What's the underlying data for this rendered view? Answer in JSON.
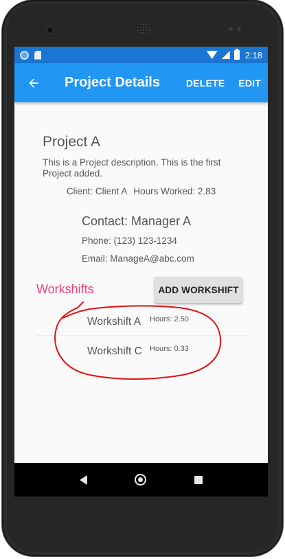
{
  "status_bar": {
    "time": "2:18",
    "icons": [
      "notification-icon",
      "sd-card-icon",
      "wifi-icon",
      "signal-icon",
      "battery-charging-icon"
    ]
  },
  "app_bar": {
    "back_icon": "arrow-back-icon",
    "title": "Project Details",
    "delete_label": "DELETE",
    "edit_label": "EDIT",
    "background_color": "#2196f3",
    "status_color": "#1976d2"
  },
  "project": {
    "name": "Project A",
    "description": "This is a Project description. This is the first Project added.",
    "client": "Client: Client A",
    "hours_worked": "Hours Worked: 2.83"
  },
  "contact": {
    "name": "Contact: Manager A",
    "phone": "Phone: (123) 123-1234",
    "email": "Email: ManageA@abc.com"
  },
  "workshifts": {
    "title": "Workshifts",
    "title_color": "#ec407a",
    "add_label": "ADD WORKSHIFT",
    "items": [
      {
        "name": "Workshift A",
        "hours": "Hours: 2.50"
      },
      {
        "name": "Workshift C",
        "hours": "Hours: 0.33"
      }
    ]
  },
  "annotation": {
    "color": "#e01010"
  },
  "nav_bar": {
    "icons": [
      "nav-back-icon",
      "nav-home-icon",
      "nav-recents-icon"
    ]
  }
}
